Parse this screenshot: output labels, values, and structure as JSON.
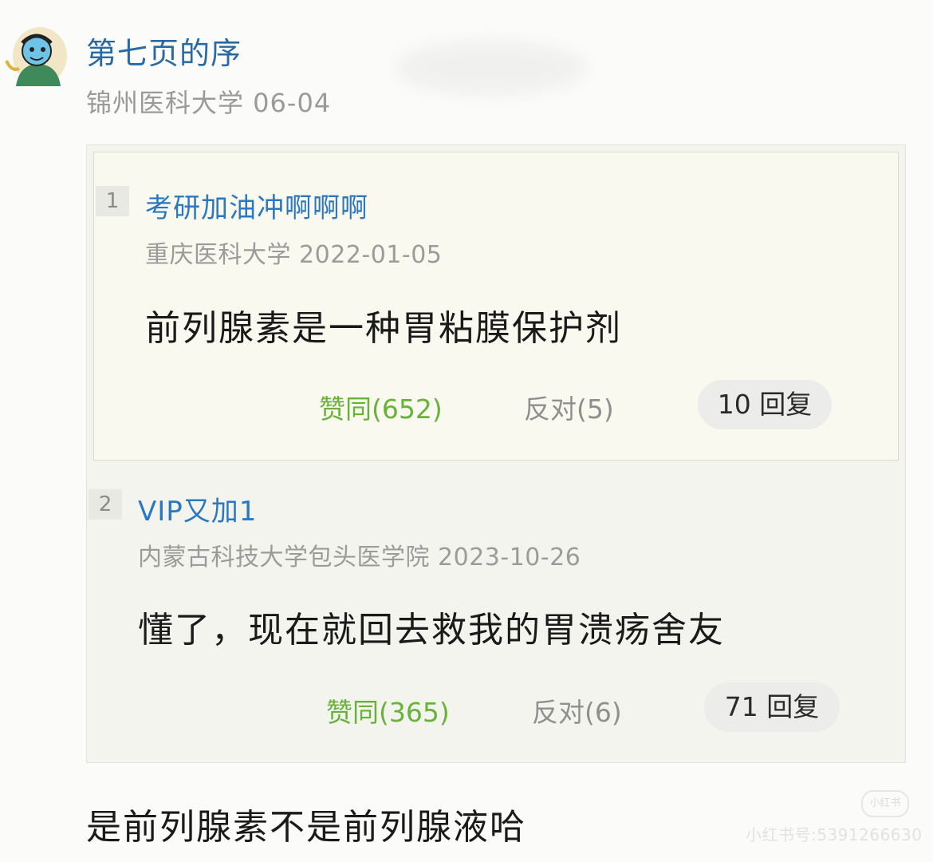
{
  "header": {
    "username": "第七页的序",
    "meta": "锦州医科大学 06-04"
  },
  "quotes": [
    {
      "index": "1",
      "name": "考研加油冲啊啊啊",
      "meta": "重庆医科大学 2022-01-05",
      "text": "前列腺素是一种胃粘膜保护剂",
      "agree": "赞同(652)",
      "oppose": "反对(5)",
      "replies": "10 回复"
    },
    {
      "index": "2",
      "name": "VIP又加1",
      "meta": "内蒙古科技大学包头医学院 2023-10-26",
      "text": "懂了，现在就回去救我的胃溃疡舍友",
      "agree": "赞同(365)",
      "oppose": "反对(6)",
      "replies": "71 回复"
    }
  ],
  "reply": {
    "text": "是前列腺素不是前列腺液哈"
  },
  "watermark": {
    "logo": "小红书",
    "text": "小红书号:5391266630"
  },
  "colors": {
    "username": "#2a6aa3",
    "quote_name": "#2a78c2",
    "agree": "#69b23a",
    "muted": "#9a9a9a"
  }
}
